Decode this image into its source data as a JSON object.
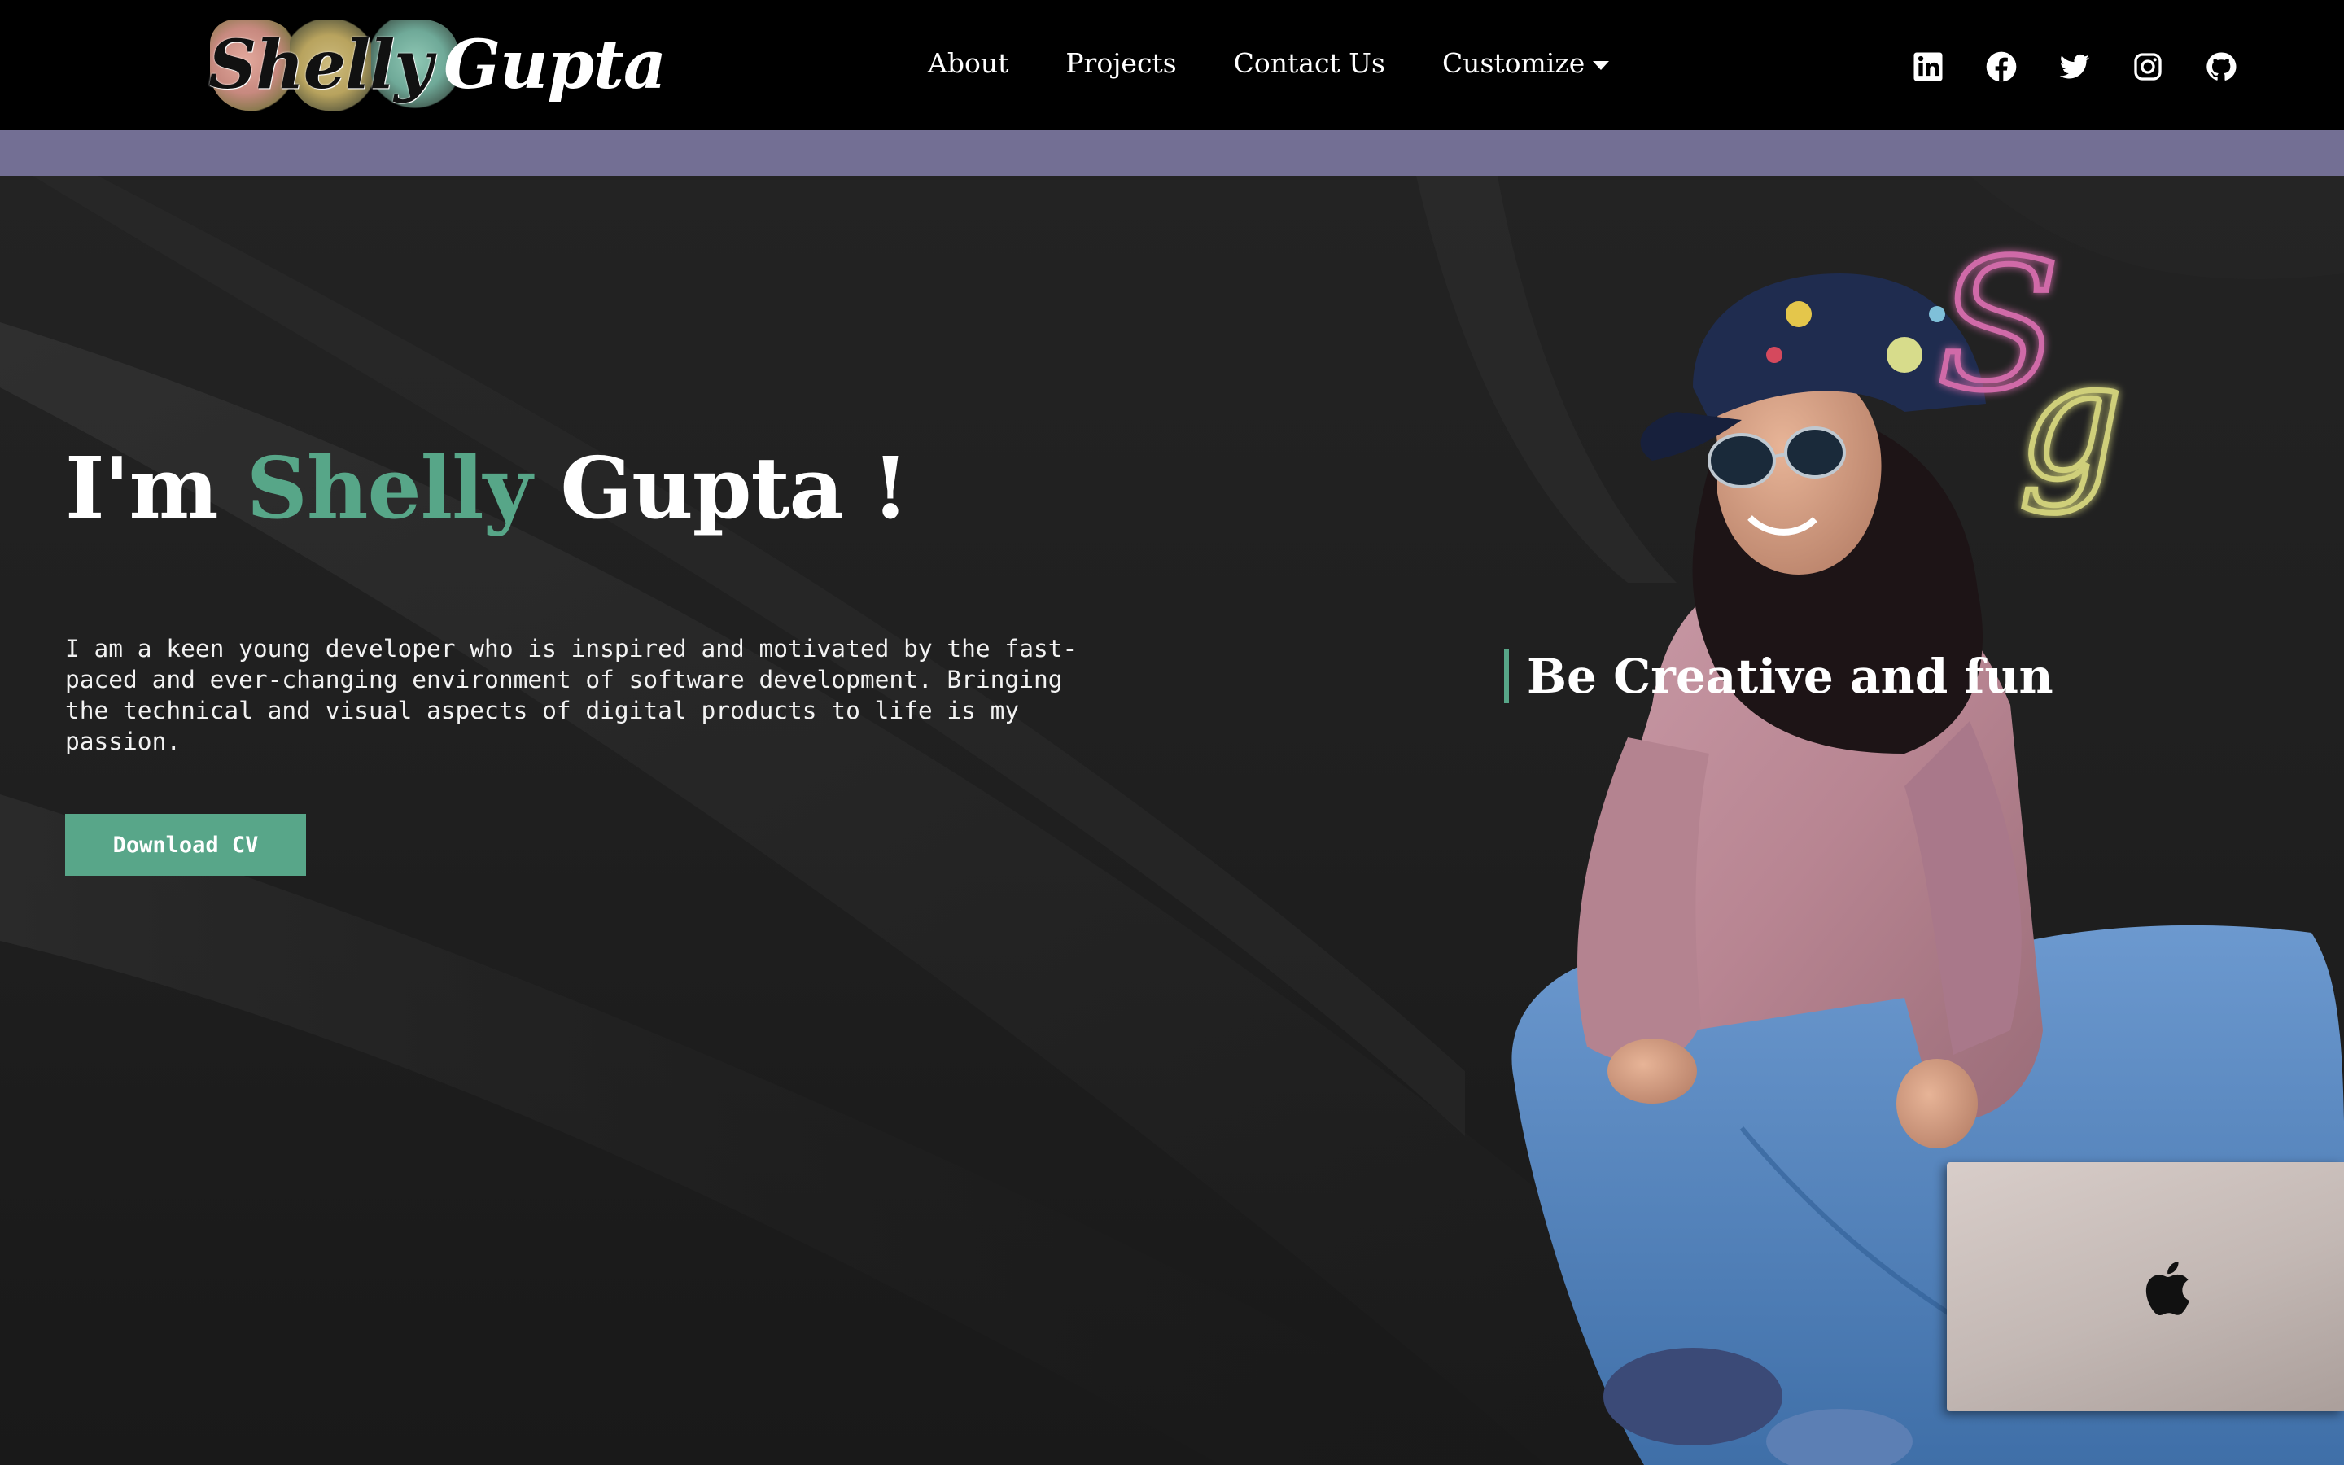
{
  "header": {
    "logo": {
      "first": "Shelly",
      "last": "Gupta"
    },
    "nav": [
      {
        "label": "About"
      },
      {
        "label": "Projects"
      },
      {
        "label": "Contact Us"
      },
      {
        "label": "Customize"
      }
    ],
    "socials": [
      "linkedin-icon",
      "facebook-icon",
      "twitter-icon",
      "instagram-icon",
      "github-icon"
    ]
  },
  "hero": {
    "greeting_prefix": "I'm",
    "greeting_first": "Shelly",
    "greeting_last": "Gupta !",
    "intro": "I am a keen young developer who is inspired and motivated by the fast-paced and ever-changing environment of software development. Bringing the technical and visual aspects of digital products to life is my passion.",
    "cta_label": "Download CV",
    "tagline": "Be Creative and fun",
    "neon_letters": "Sg"
  },
  "colors": {
    "header_bg": "#000000",
    "accent_strip": "#736f94",
    "accent_green": "#57a688",
    "hero_bg": "#1f1f1f",
    "text": "#ffffff"
  }
}
